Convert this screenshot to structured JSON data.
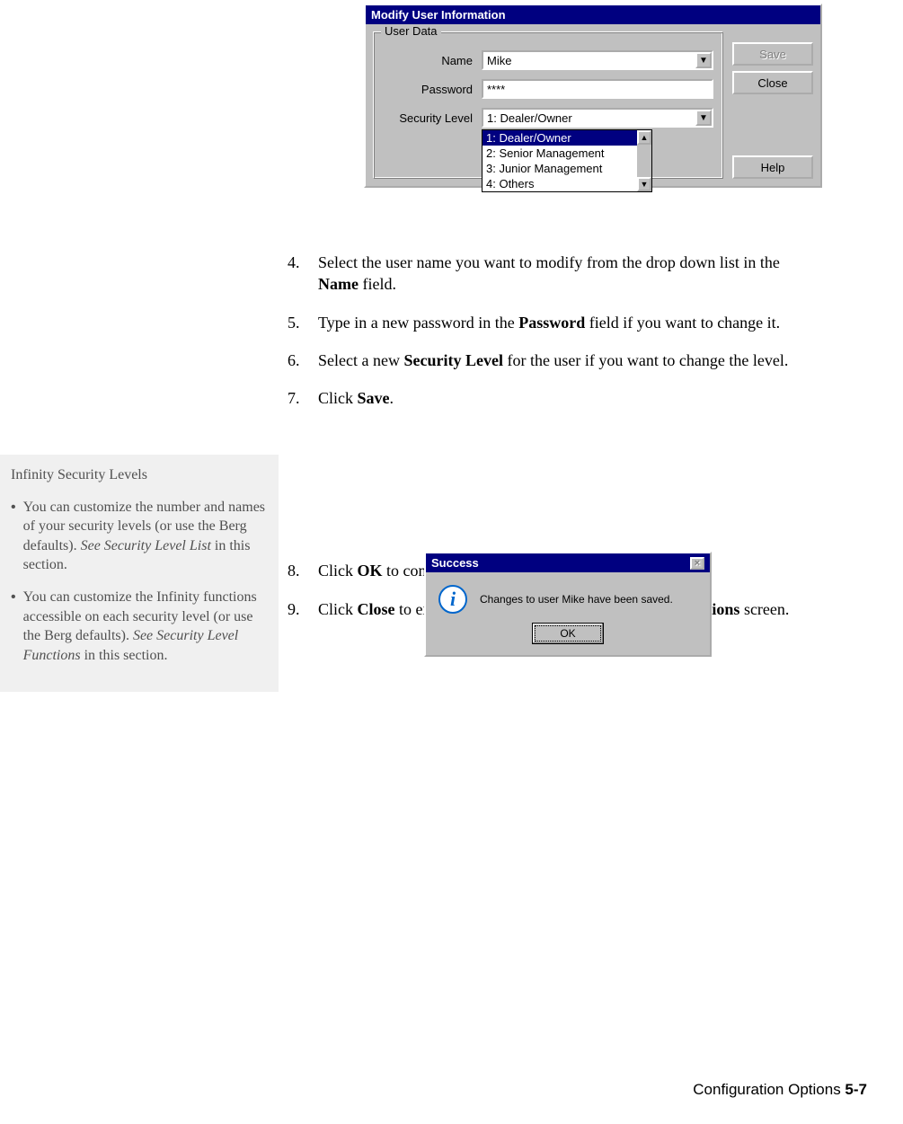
{
  "modify_dialog": {
    "title": "Modify User Information",
    "fieldset_legend": "User Data",
    "name_label": "Name",
    "name_value": "Mike",
    "password_label": "Password",
    "password_value": "****",
    "security_label": "Security Level",
    "security_value": "1: Dealer/Owner",
    "options": [
      "1: Dealer/Owner",
      "2: Senior Management",
      "3: Junior Management",
      "4: Others"
    ],
    "save_label": "Save",
    "close_label": "Close",
    "help_label": "Help"
  },
  "steps": {
    "s4_num": "4.",
    "s4a": "Select the user name you want to modify from the drop down list in the ",
    "s4b": "Name",
    "s4c": " field.",
    "s5_num": "5.",
    "s5a": "Type in a new password in the ",
    "s5b": "Password",
    "s5c": " field if you want to change it.",
    "s6_num": "6.",
    "s6a": "Select a new ",
    "s6b": "Security Level",
    "s6c": " for the user if you want to change the level.",
    "s7_num": "7.",
    "s7a": "Click ",
    "s7b": "Save",
    "s7c": ".",
    "s8_num": "8.",
    "s8a": " Click ",
    "s8b": "OK",
    "s8c": " to confirm the save.",
    "s9_num": "9.",
    "s9a": "Click ",
    "s9b": "Close",
    "s9c": " to exit the screen and return to the ",
    "s9d": "Security Options",
    "s9e": " screen."
  },
  "success": {
    "title": "Success",
    "message": "Changes to user Mike have been saved.",
    "ok": "OK"
  },
  "sidebar": {
    "heading": "Infinity Security Levels",
    "b1a": "You can customize the number and names of your security levels (or use the Berg defaults). ",
    "b1b": "See Security Level List",
    "b1c": " in this section.",
    "b2a": "You can customize the Infinity functions accessible on each security level (or use the Berg defaults). ",
    "b2b": "See Security Level Functions",
    "b2c": " in this section."
  },
  "footer": {
    "section": "Configuration Options  ",
    "page": "5-7"
  }
}
